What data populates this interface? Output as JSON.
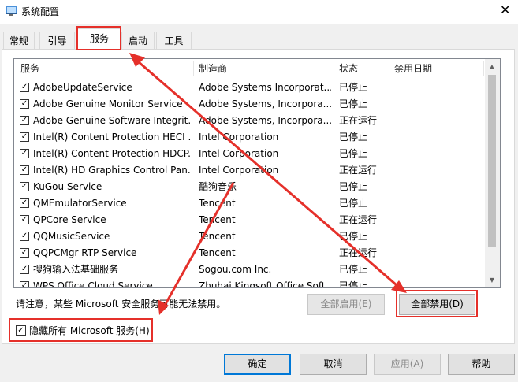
{
  "window": {
    "title": "系统配置",
    "close_glyph": "✕"
  },
  "tabs": [
    {
      "label": "常规"
    },
    {
      "label": "引导"
    },
    {
      "label": "服务"
    },
    {
      "label": "启动"
    },
    {
      "label": "工具"
    }
  ],
  "table": {
    "headers": [
      "服务",
      "制造商",
      "状态",
      "禁用日期"
    ],
    "rows": [
      {
        "service": "AdobeUpdateService",
        "manufacturer": "Adobe Systems Incorporat...",
        "status": "已停止",
        "date": ""
      },
      {
        "service": "Adobe Genuine Monitor Service",
        "manufacturer": "Adobe Systems, Incorpora...",
        "status": "已停止",
        "date": ""
      },
      {
        "service": "Adobe Genuine Software Integrit...",
        "manufacturer": "Adobe Systems, Incorpora...",
        "status": "正在运行",
        "date": ""
      },
      {
        "service": "Intel(R) Content Protection HECI ...",
        "manufacturer": "Intel Corporation",
        "status": "已停止",
        "date": ""
      },
      {
        "service": "Intel(R) Content Protection HDCP...",
        "manufacturer": "Intel Corporation",
        "status": "已停止",
        "date": ""
      },
      {
        "service": "Intel(R) HD Graphics Control Pan...",
        "manufacturer": "Intel Corporation",
        "status": "正在运行",
        "date": ""
      },
      {
        "service": "KuGou Service",
        "manufacturer": "酷狗音乐",
        "status": "已停止",
        "date": ""
      },
      {
        "service": "QMEmulatorService",
        "manufacturer": "Tencent",
        "status": "已停止",
        "date": ""
      },
      {
        "service": "QPCore Service",
        "manufacturer": "Tencent",
        "status": "正在运行",
        "date": ""
      },
      {
        "service": "QQMusicService",
        "manufacturer": "Tencent",
        "status": "已停止",
        "date": ""
      },
      {
        "service": "QQPCMgr RTP Service",
        "manufacturer": "Tencent",
        "status": "正在运行",
        "date": ""
      },
      {
        "service": "搜狗输入法基础服务",
        "manufacturer": "Sogou.com Inc.",
        "status": "已停止",
        "date": ""
      },
      {
        "service": "WPS Office Cloud Service",
        "manufacturer": "Zhuhai Kingsoft Office Soft...",
        "status": "已停止",
        "date": ""
      }
    ]
  },
  "note": "请注意，某些 Microsoft 安全服务可能无法禁用。",
  "buttons": {
    "enable_all": "全部启用(E)",
    "disable_all": "全部禁用(D)",
    "ok": "确定",
    "cancel": "取消",
    "apply": "应用(A)",
    "help": "帮助"
  },
  "hide_ms": {
    "label": "隐藏所有 Microsoft 服务(H)",
    "checked": true
  },
  "check_glyph": "✓",
  "annotation_color": "#e5302a"
}
